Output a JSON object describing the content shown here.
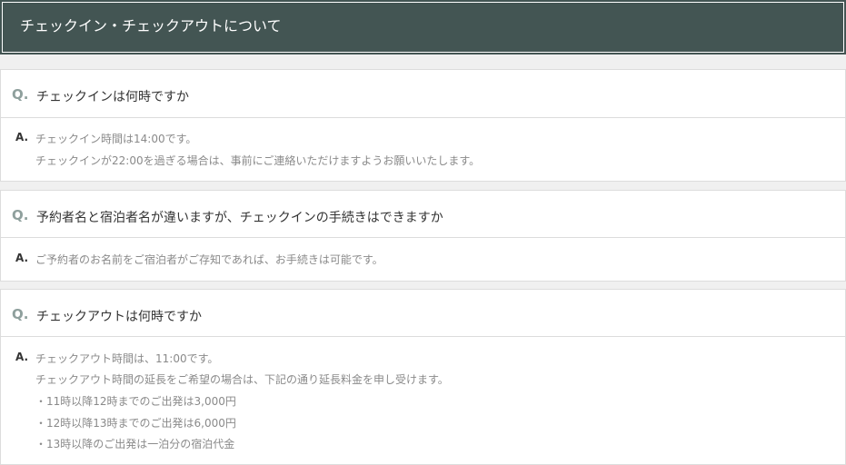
{
  "header": {
    "title": "チェックイン・チェックアウトについて"
  },
  "faq": [
    {
      "q_mark": "Q.",
      "question": "チェックインは何時ですか",
      "a_mark": "A.",
      "answer": [
        "チェックイン時間は14:00です。",
        "チェックインが22:00を過ぎる場合は、事前にご連絡いただけますようお願いいたします。"
      ]
    },
    {
      "q_mark": "Q.",
      "question": "予約者名と宿泊者名が違いますが、チェックインの手続きはできますか",
      "a_mark": "A.",
      "answer": [
        "ご予約者のお名前をご宿泊者がご存知であれば、お手続きは可能です。"
      ]
    },
    {
      "q_mark": "Q.",
      "question": "チェックアウトは何時ですか",
      "a_mark": "A.",
      "answer": [
        "チェックアウト時間は、11:00です。",
        "チェックアウト時間の延長をご希望の場合は、下記の通り延長料金を申し受けます。",
        "・11時以降12時までのご出発は3,000円",
        "・12時以降13時までのご出発は6,000円",
        "・13時以降のご出発は一泊分の宿泊代金"
      ]
    }
  ]
}
